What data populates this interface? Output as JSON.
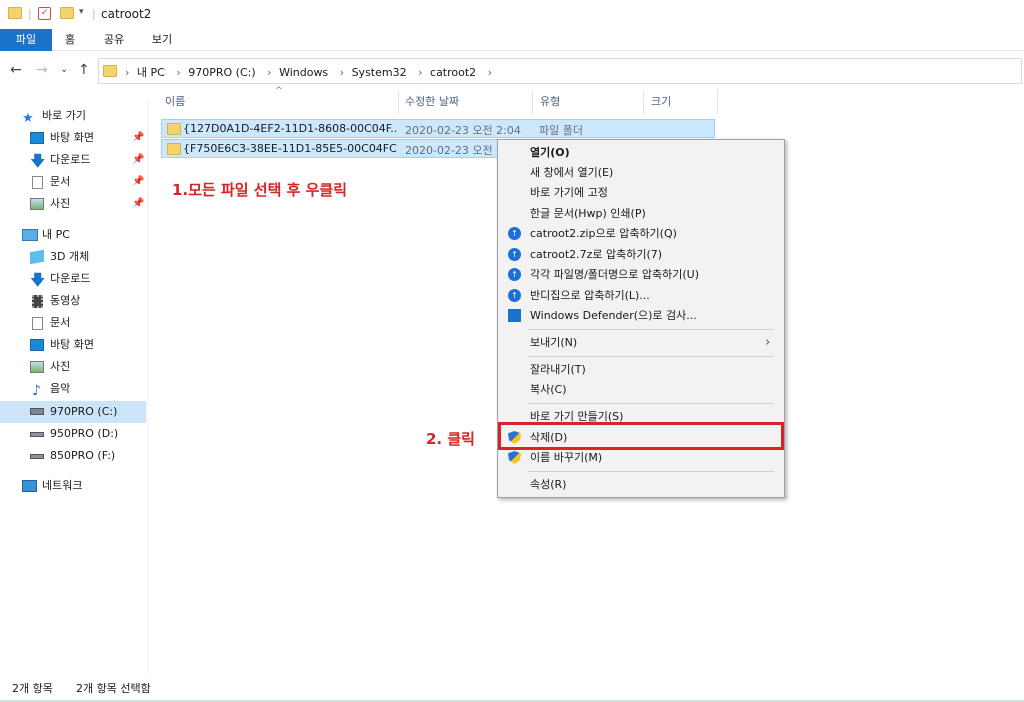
{
  "window": {
    "title": "catroot2"
  },
  "ribbon": {
    "tabs": [
      "파일",
      "홈",
      "공유",
      "보기"
    ]
  },
  "address": {
    "crumbs": [
      "내 PC",
      "970PRO (C:)",
      "Windows",
      "System32",
      "catroot2"
    ]
  },
  "sidebar": {
    "quick_access": "바로 가기",
    "quick_items": [
      "바탕 화면",
      "다운로드",
      "문서",
      "사진"
    ],
    "this_pc": "내 PC",
    "pc_items": [
      "3D 개체",
      "다운로드",
      "동영상",
      "문서",
      "바탕 화면",
      "사진",
      "음악",
      "970PRO (C:)",
      "950PRO (D:)",
      "850PRO (F:)"
    ],
    "network": "네트워크"
  },
  "columns": {
    "name": "이름",
    "date": "수정한 날짜",
    "type": "유형",
    "size": "크기"
  },
  "files": [
    {
      "name": "{127D0A1D-4EF2-11D1-8608-00C04F...",
      "date": "2020-02-23 오전 2:04",
      "type": "파일 폴더"
    },
    {
      "name": "{F750E6C3-38EE-11D1-85E5-00C04FC...",
      "date": "2020-02-23 오전",
      "type": ""
    }
  ],
  "annotations": {
    "step1": "1.모든 파일 선택 후 우클릭",
    "step2": "2. 클릭"
  },
  "context_menu": {
    "open": "열기(O)",
    "open_new": "새 창에서 열기(E)",
    "pin": "바로 가기에 고정",
    "print_hwp": "한글 문서(Hwp) 인쇄(P)",
    "zip": "catroot2.zip으로 압축하기(Q)",
    "sevenz": "catroot2.7z로 압축하기(7)",
    "each": "각각 파일명/폴더명으로 압축하기(U)",
    "bandizip": "반디집으로 압축하기(L)...",
    "defender": "Windows Defender(으)로 검사...",
    "send_to": "보내기(N)",
    "cut": "잘라내기(T)",
    "copy": "복사(C)",
    "shortcut": "바로 가기 만들기(S)",
    "delete": "삭제(D)",
    "rename": "이름 바꾸기(M)",
    "properties": "속성(R)"
  },
  "status": {
    "count": "2개 항목",
    "selected": "2개 항목 선택함"
  },
  "colors": {
    "accent": "#1a73c9",
    "selection": "#cce8ff",
    "annotation": "#d62525"
  }
}
